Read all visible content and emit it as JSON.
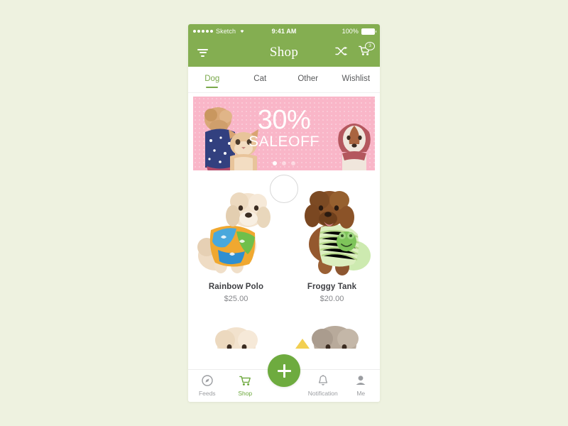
{
  "colors": {
    "brand_green": "#84ae51",
    "accent_green": "#6eab3f",
    "banner_pink": "#f9b6c8",
    "page_background": "#eef2e0",
    "inactive_gray": "#9b9da1"
  },
  "status_bar": {
    "carrier": "Sketch",
    "signal_dots": 5,
    "wifi_icon": "wifi-icon",
    "time": "9:41 AM",
    "battery_percent": "100%"
  },
  "nav_bar": {
    "menu_icon": "filter-menu-icon",
    "title": "Shop",
    "shuffle_icon": "shuffle-icon",
    "cart_icon": "cart-icon",
    "cart_badge": "3"
  },
  "category_tabs": [
    {
      "label": "Dog",
      "active": true
    },
    {
      "label": "Cat",
      "active": false
    },
    {
      "label": "Other",
      "active": false
    },
    {
      "label": "Wishlist",
      "active": false
    }
  ],
  "banner": {
    "percent": "30%",
    "subtitle": "SALEOFF",
    "dots_total": 3,
    "dots_active_index": 0
  },
  "products": [
    {
      "name": "Rainbow Polo",
      "price": "$25.00"
    },
    {
      "name": "Froggy Tank",
      "price": "$20.00"
    }
  ],
  "tab_bar": {
    "items": [
      {
        "label": "Feeds",
        "icon": "compass-icon",
        "active": false
      },
      {
        "label": "Shop",
        "icon": "cart-icon",
        "active": true
      },
      {
        "label": "Notification",
        "icon": "bell-icon",
        "active": false
      },
      {
        "label": "Me",
        "icon": "person-icon",
        "active": false
      }
    ],
    "fab_icon": "plus-icon"
  }
}
